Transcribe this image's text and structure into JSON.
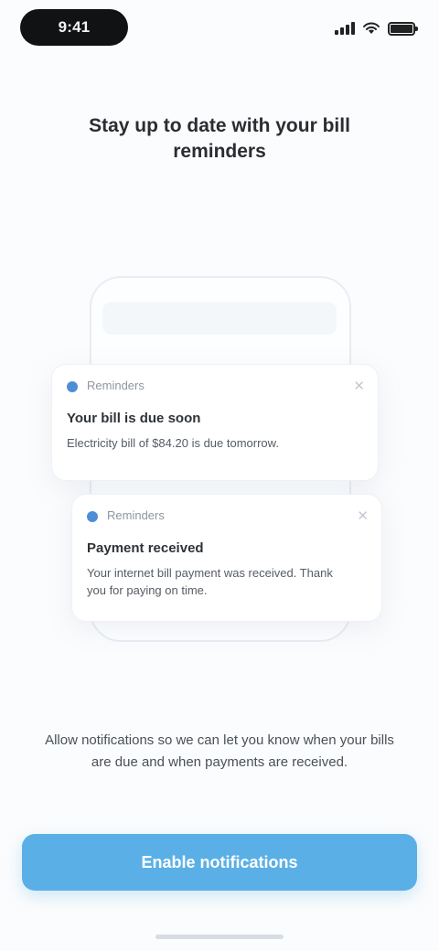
{
  "status_bar": {
    "time": "9:41",
    "signal_icon": "signal-icon",
    "wifi_icon": "wifi-icon",
    "battery_icon": "battery-icon",
    "battery_level": 1.0
  },
  "title": "Stay up to date with your bill reminders",
  "illustration": {
    "card_a": {
      "icon": "bell-icon",
      "app": "Reminders",
      "title": "Your bill is due soon",
      "body": "Electricity bill of $84.20 is due tomorrow."
    },
    "card_b": {
      "icon": "bell-icon",
      "app": "Reminders",
      "title": "Payment received",
      "body": "Your internet bill payment was received. Thank you for paying on time."
    }
  },
  "description": "Allow notifications so we can let you know when your bills are due and when payments are received.",
  "cta_label": "Enable notifications",
  "colors": {
    "accent": "#5ab0e6",
    "dot": "#4d8fd6",
    "background": "#fbfcfd"
  }
}
